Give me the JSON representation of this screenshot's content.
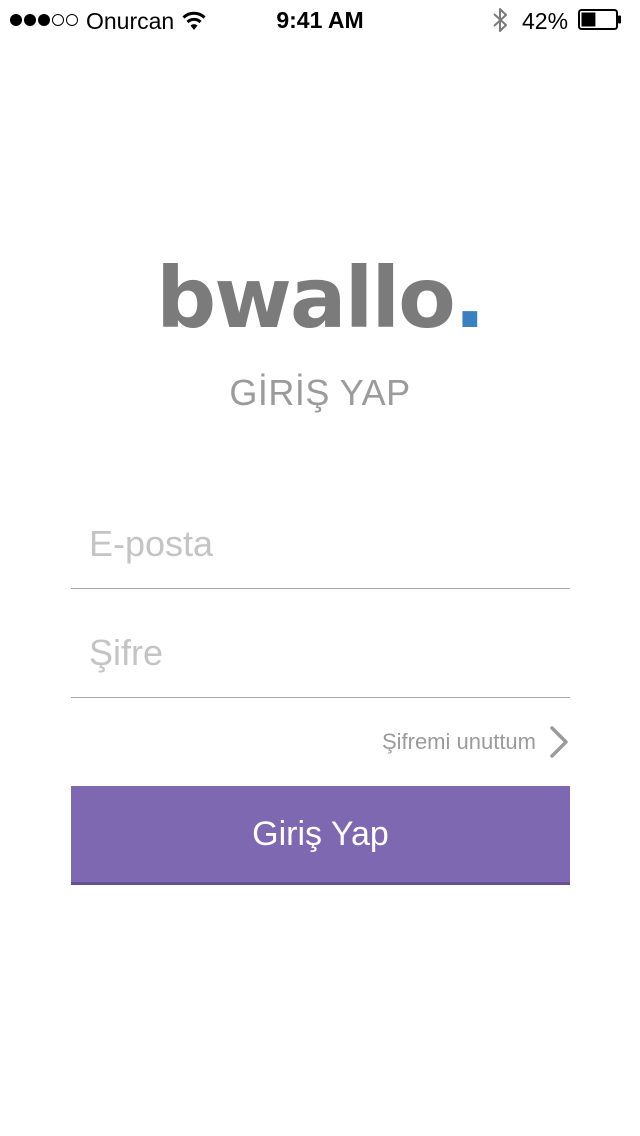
{
  "status_bar": {
    "signal_filled": 3,
    "signal_total": 5,
    "carrier": "Onurcan",
    "time": "9:41 AM",
    "battery_percent_label": "42%",
    "battery_level": 0.42,
    "icons": [
      "wifi-icon",
      "bluetooth-icon",
      "battery-icon"
    ]
  },
  "logo": {
    "text": "bwallo",
    "dot": ".",
    "text_color": "#7b7b7b",
    "dot_color": "#3a7fc0"
  },
  "heading": "GİRİŞ YAP",
  "form": {
    "email_placeholder": "E-posta",
    "email_value": "",
    "password_placeholder": "Şifre",
    "password_value": "",
    "forgot_label": "Şifremi unuttum",
    "forgot_icon": "chevron-right-icon",
    "submit_label": "Giriş Yap",
    "submit_color": "#7e68b1"
  }
}
